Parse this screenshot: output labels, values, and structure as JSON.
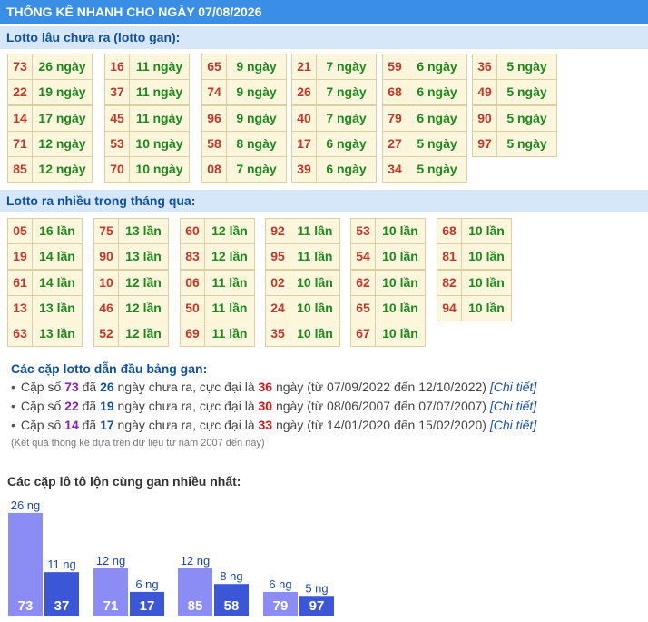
{
  "title": "THỐNG KÊ NHANH CHO NGÀY 07/08/2026",
  "gan_section": {
    "heading": "Lotto lâu chưa ra (lotto gan):",
    "columns": [
      [
        {
          "num": "73",
          "val": "26 ngày"
        },
        {
          "num": "22",
          "val": "19 ngày"
        },
        {
          "num": "14",
          "val": "17 ngày"
        },
        {
          "num": "71",
          "val": "12 ngày"
        },
        {
          "num": "85",
          "val": "12 ngày"
        }
      ],
      [
        {
          "num": "16",
          "val": "11 ngày"
        },
        {
          "num": "37",
          "val": "11 ngày"
        },
        {
          "num": "45",
          "val": "11 ngày"
        },
        {
          "num": "53",
          "val": "10 ngày"
        },
        {
          "num": "70",
          "val": "10 ngày"
        }
      ],
      [
        {
          "num": "65",
          "val": "9 ngày"
        },
        {
          "num": "74",
          "val": "9 ngày"
        },
        {
          "num": "96",
          "val": "9 ngày"
        },
        {
          "num": "58",
          "val": "8 ngày"
        },
        {
          "num": "08",
          "val": "7 ngày"
        }
      ],
      [
        {
          "num": "21",
          "val": "7 ngày"
        },
        {
          "num": "26",
          "val": "7 ngày"
        },
        {
          "num": "40",
          "val": "7 ngày"
        },
        {
          "num": "17",
          "val": "6 ngày"
        },
        {
          "num": "39",
          "val": "6 ngày"
        }
      ],
      [
        {
          "num": "59",
          "val": "6 ngày"
        },
        {
          "num": "68",
          "val": "6 ngày"
        },
        {
          "num": "79",
          "val": "6 ngày"
        },
        {
          "num": "27",
          "val": "5 ngày"
        },
        {
          "num": "34",
          "val": "5 ngày"
        }
      ],
      [
        {
          "num": "36",
          "val": "5 ngày"
        },
        {
          "num": "49",
          "val": "5 ngày"
        },
        {
          "num": "90",
          "val": "5 ngày"
        },
        {
          "num": "97",
          "val": "5 ngày"
        }
      ]
    ]
  },
  "frequent_section": {
    "heading": "Lotto ra nhiều trong tháng qua:",
    "columns": [
      [
        {
          "num": "05",
          "val": "16 lần"
        },
        {
          "num": "19",
          "val": "14 lần"
        },
        {
          "num": "61",
          "val": "14 lần"
        },
        {
          "num": "13",
          "val": "13 lần"
        },
        {
          "num": "63",
          "val": "13 lần"
        }
      ],
      [
        {
          "num": "75",
          "val": "13 lần"
        },
        {
          "num": "90",
          "val": "13 lần"
        },
        {
          "num": "10",
          "val": "12 lần"
        },
        {
          "num": "46",
          "val": "12 lần"
        },
        {
          "num": "52",
          "val": "12 lần"
        }
      ],
      [
        {
          "num": "60",
          "val": "12 lần"
        },
        {
          "num": "83",
          "val": "12 lần"
        },
        {
          "num": "06",
          "val": "11 lần"
        },
        {
          "num": "50",
          "val": "11 lần"
        },
        {
          "num": "69",
          "val": "11 lần"
        }
      ],
      [
        {
          "num": "92",
          "val": "11 lần"
        },
        {
          "num": "95",
          "val": "11 lần"
        },
        {
          "num": "02",
          "val": "10 lần"
        },
        {
          "num": "24",
          "val": "10 lần"
        },
        {
          "num": "35",
          "val": "10 lần"
        }
      ],
      [
        {
          "num": "53",
          "val": "10 lần"
        },
        {
          "num": "54",
          "val": "10 lần"
        },
        {
          "num": "62",
          "val": "10 lần"
        },
        {
          "num": "65",
          "val": "10 lần"
        },
        {
          "num": "67",
          "val": "10 lần"
        }
      ],
      [
        {
          "num": "68",
          "val": "10 lần"
        },
        {
          "num": "81",
          "val": "10 lần"
        },
        {
          "num": "82",
          "val": "10 lần"
        },
        {
          "num": "94",
          "val": "10 lần"
        }
      ]
    ]
  },
  "pairs_section": {
    "heading": "Các cặp lotto dẫn đầu bảng gan:",
    "prefix": "Cặp số",
    "text_da": "đã",
    "text_mid": "ngày chưa ra, cực đại là",
    "text_ngay": "ngày",
    "link_label": "[Chi tiết]",
    "items": [
      {
        "pair": "73",
        "days": "26",
        "max": "36",
        "range": "(từ 07/09/2022 đến 12/10/2022)"
      },
      {
        "pair": "22",
        "days": "19",
        "max": "30",
        "range": "(từ 08/06/2007 đến 07/07/2007)"
      },
      {
        "pair": "14",
        "days": "17",
        "max": "33",
        "range": "(từ 14/01/2020 đến 15/02/2020)"
      }
    ],
    "footnote": "(Kết quả thống kê dựa trên dữ liệu từ năm 2007 đến nay)"
  },
  "chart_data": {
    "type": "bar",
    "title": "Các cặp lô tô lộn cùng gan nhiều nhất:",
    "unit_suffix": " ng",
    "groups": [
      {
        "bars": [
          {
            "label": "73",
            "value": 26
          },
          {
            "label": "37",
            "value": 11
          }
        ]
      },
      {
        "bars": [
          {
            "label": "71",
            "value": 12
          },
          {
            "label": "17",
            "value": 6
          }
        ]
      },
      {
        "bars": [
          {
            "label": "85",
            "value": 12
          },
          {
            "label": "58",
            "value": 8
          }
        ]
      },
      {
        "bars": [
          {
            "label": "79",
            "value": 6
          },
          {
            "label": "97",
            "value": 5
          }
        ]
      }
    ],
    "colors": {
      "first": "#8c8cf5",
      "second": "#3b56d6",
      "value_label": "#1a46b8"
    }
  }
}
